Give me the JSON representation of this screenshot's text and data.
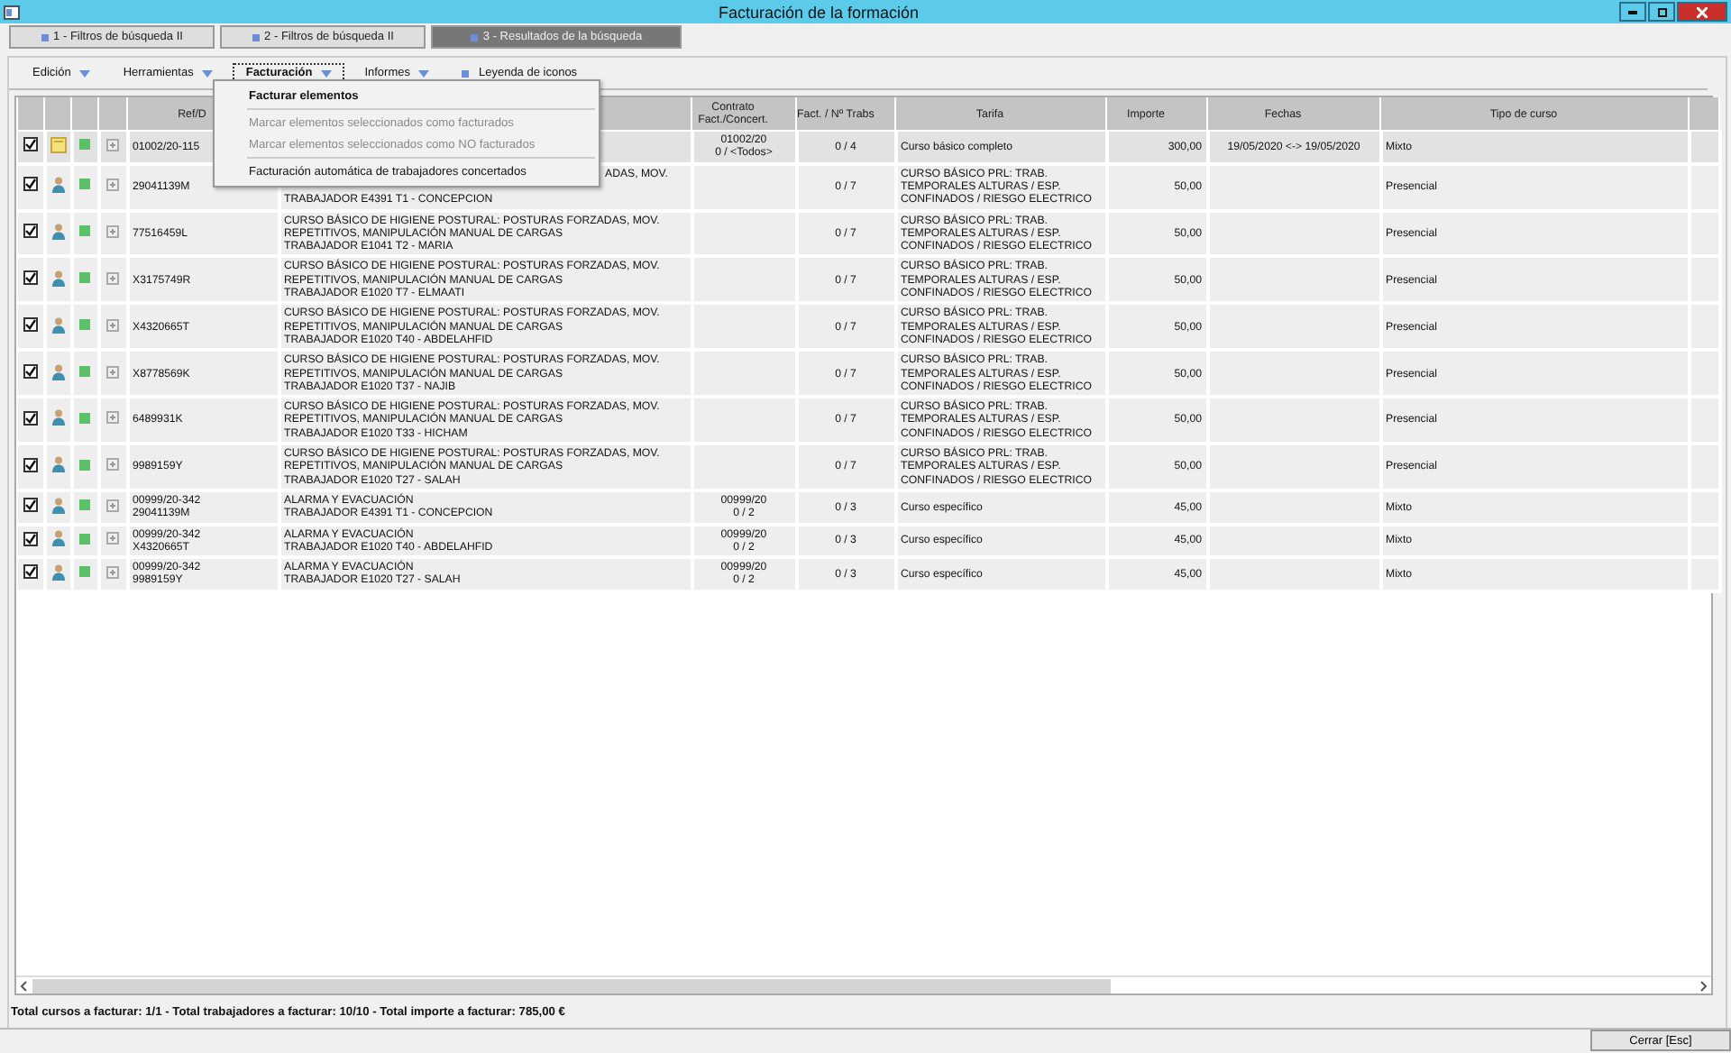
{
  "window": {
    "title": "Facturación de la formación"
  },
  "tabs": [
    {
      "label": "1 - Filtros de búsqueda II",
      "selected": false
    },
    {
      "label": "2 - Filtros de búsqueda II",
      "selected": false
    },
    {
      "label": "3 - Resultados de la búsqueda",
      "selected": true
    }
  ],
  "toolbar": [
    {
      "label": "Edición",
      "kind": "dropdown",
      "open": false
    },
    {
      "label": "Herramientas",
      "kind": "dropdown",
      "open": false
    },
    {
      "label": "Facturación",
      "kind": "dropdown",
      "open": true
    },
    {
      "label": "Informes",
      "kind": "dropdown",
      "open": false
    },
    {
      "label": "Leyenda de iconos",
      "kind": "button",
      "open": false
    }
  ],
  "menu": {
    "items": [
      {
        "kind": "item",
        "label": "Facturar elementos",
        "default": true,
        "disabled": false
      },
      {
        "kind": "separator"
      },
      {
        "kind": "item",
        "label": "Marcar elementos seleccionados como facturados",
        "default": false,
        "disabled": true
      },
      {
        "kind": "item",
        "label": "Marcar elementos seleccionados como NO facturados",
        "default": false,
        "disabled": true
      },
      {
        "kind": "separator"
      },
      {
        "kind": "item",
        "label": "Facturación automática de trabajadores concertados",
        "default": false,
        "disabled": false
      }
    ]
  },
  "table": {
    "columns": [
      {
        "kind": "check"
      },
      {
        "kind": "icon"
      },
      {
        "kind": "icon"
      },
      {
        "kind": "icon"
      },
      {
        "kind": "text",
        "label": "Ref/D"
      },
      {
        "kind": "text"
      },
      {
        "kind": "text",
        "label": "Contrato\nFact./Concert."
      },
      {
        "kind": "text",
        "label": "Fact. / Nº Trabs"
      },
      {
        "kind": "text",
        "label": "Tarifa"
      },
      {
        "kind": "text",
        "label": "Importe"
      },
      {
        "kind": "text",
        "label": "Fechas"
      },
      {
        "kind": "text",
        "label": "Tipo de curso"
      },
      {
        "kind": "text"
      }
    ],
    "rows": [
      {
        "selected": true,
        "checked": true,
        "kind": "note",
        "ref": "01002/20-115",
        "contract": "01002/20\n0 / <Todos>",
        "workers": "0 / 4",
        "rate": "Curso básico completo",
        "amount": "300,00",
        "dates": "19/05/2020 <-> 19/05/2020",
        "type": "Mixto"
      },
      {
        "selected": false,
        "checked": true,
        "kind": "person",
        "ref": "29041139M",
        "course_fragment": "ADAS, MOV.",
        "course": "TRABAJADOR E4391 T1 - CONCEPCION",
        "workers": "0 / 7",
        "rate": "CURSO BÁSICO PRL: TRAB.\nTEMPORALES ALTURAS / ESP.\nCONFINADOS / RIESGO ELECTRICO",
        "amount": "50,00",
        "type": "Presencial"
      },
      {
        "selected": false,
        "checked": true,
        "kind": "person",
        "ref": "77516459L",
        "course": "CURSO BÁSICO DE HIGIENE POSTURAL: POSTURAS FORZADAS, MOV.\nREPETITIVOS, MANIPULACIÓN MANUAL DE CARGAS\nTRABAJADOR E1041 T2 - MARIA",
        "workers": "0 / 7",
        "rate": "CURSO BÁSICO PRL: TRAB.\nTEMPORALES ALTURAS / ESP.\nCONFINADOS / RIESGO ELECTRICO",
        "amount": "50,00",
        "type": "Presencial"
      },
      {
        "selected": false,
        "checked": true,
        "kind": "person",
        "ref": "X3175749R",
        "course": "CURSO BÁSICO DE HIGIENE POSTURAL: POSTURAS FORZADAS, MOV.\nREPETITIVOS, MANIPULACIÓN MANUAL DE CARGAS\nTRABAJADOR E1020 T7 - ELMAATI",
        "workers": "0 / 7",
        "rate": "CURSO BÁSICO PRL: TRAB.\nTEMPORALES ALTURAS / ESP.\nCONFINADOS / RIESGO ELECTRICO",
        "amount": "50,00",
        "type": "Presencial"
      },
      {
        "selected": false,
        "checked": true,
        "kind": "person",
        "ref": "X4320665T",
        "course": "CURSO BÁSICO DE HIGIENE POSTURAL: POSTURAS FORZADAS, MOV.\nREPETITIVOS, MANIPULACIÓN MANUAL DE CARGAS\nTRABAJADOR E1020 T40 - ABDELAHFID",
        "workers": "0 / 7",
        "rate": "CURSO BÁSICO PRL: TRAB.\nTEMPORALES ALTURAS / ESP.\nCONFINADOS / RIESGO ELECTRICO",
        "amount": "50,00",
        "type": "Presencial"
      },
      {
        "selected": false,
        "checked": true,
        "kind": "person",
        "ref": "X8778569K",
        "course": "CURSO BÁSICO DE HIGIENE POSTURAL: POSTURAS FORZADAS, MOV.\nREPETITIVOS, MANIPULACIÓN MANUAL DE CARGAS\nTRABAJADOR E1020 T37 - NAJIB",
        "workers": "0 / 7",
        "rate": "CURSO BÁSICO PRL: TRAB.\nTEMPORALES ALTURAS / ESP.\nCONFINADOS / RIESGO ELECTRICO",
        "amount": "50,00",
        "type": "Presencial"
      },
      {
        "selected": false,
        "checked": true,
        "kind": "person",
        "ref": "6489931K",
        "course": "CURSO BÁSICO DE HIGIENE POSTURAL: POSTURAS FORZADAS, MOV.\nREPETITIVOS, MANIPULACIÓN MANUAL DE CARGAS\nTRABAJADOR E1020 T33 - HICHAM",
        "workers": "0 / 7",
        "rate": "CURSO BÁSICO PRL: TRAB.\nTEMPORALES ALTURAS / ESP.\nCONFINADOS / RIESGO ELECTRICO",
        "amount": "50,00",
        "type": "Presencial"
      },
      {
        "selected": false,
        "checked": true,
        "kind": "person",
        "ref": "9989159Y",
        "course": "CURSO BÁSICO DE HIGIENE POSTURAL: POSTURAS FORZADAS, MOV.\nREPETITIVOS, MANIPULACIÓN MANUAL DE CARGAS\nTRABAJADOR E1020 T27 - SALAH",
        "workers": "0 / 7",
        "rate": "CURSO BÁSICO PRL: TRAB.\nTEMPORALES ALTURAS / ESP.\nCONFINADOS / RIESGO ELECTRICO",
        "amount": "50,00",
        "type": "Presencial"
      },
      {
        "selected": false,
        "checked": true,
        "kind": "person",
        "ref": "00999/20-342\n29041139M",
        "course": "ALARMA Y EVACUACIÓN\nTRABAJADOR E4391 T1 - CONCEPCION",
        "contract": "00999/20\n0 / 2",
        "workers": "0 / 3",
        "rate": "Curso específico",
        "amount": "45,00",
        "type": "Mixto"
      },
      {
        "selected": false,
        "checked": true,
        "kind": "person",
        "ref": "00999/20-342\nX4320665T",
        "course": "ALARMA Y EVACUACIÓN\nTRABAJADOR E1020 T40 - ABDELAHFID",
        "contract": "00999/20\n0 / 2",
        "workers": "0 / 3",
        "rate": "Curso específico",
        "amount": "45,00",
        "type": "Mixto"
      },
      {
        "selected": false,
        "checked": true,
        "kind": "person",
        "ref": "00999/20-342\n9989159Y",
        "course": "ALARMA Y EVACUACIÓN\nTRABAJADOR E1020 T27 - SALAH",
        "contract": "00999/20\n0 / 2",
        "workers": "0 / 3",
        "rate": "Curso específico",
        "amount": "45,00",
        "type": "Mixto"
      }
    ]
  },
  "status_bar": {
    "text": "Total cursos a facturar: 1/1 - Total trabajadores a facturar: 10/10 - Total importe a facturar: 785,00 €"
  },
  "buttons": [
    {
      "label": "Cerrar [Esc]"
    }
  ]
}
